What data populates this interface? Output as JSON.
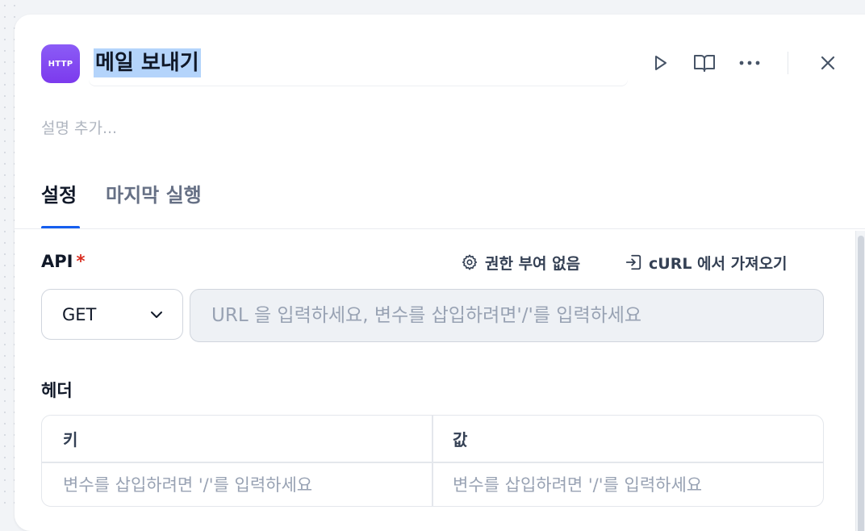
{
  "header": {
    "badge": "HTTP",
    "title": "메일 보내기",
    "actions": {
      "run": "play-icon",
      "docs": "book-open-icon",
      "more": "more-horizontal-icon",
      "close": "close-icon"
    }
  },
  "description_placeholder": "설명 추가...",
  "tabs": [
    {
      "label": "설정",
      "active": true
    },
    {
      "label": "마지막 실행",
      "active": false
    }
  ],
  "api": {
    "label": "API",
    "required_mark": "*",
    "auth_button": "권한 부여 없음",
    "import_button": "cURL 에서 가져오기",
    "method": "GET",
    "url_placeholder": "URL 을 입력하세요, 변수를 삽입하려면'/'를 입력하세요"
  },
  "headers": {
    "label": "헤더",
    "columns": [
      "키",
      "값"
    ],
    "key_placeholder": "변수를 삽입하려면 '/'를 입력하세요",
    "value_placeholder": "변수를 삽입하려면 '/'를 입력하세요"
  },
  "colors": {
    "accent": "#155eef",
    "badge": "#7c3aed",
    "required": "#d92d20",
    "selection": "#b4d4fb"
  }
}
